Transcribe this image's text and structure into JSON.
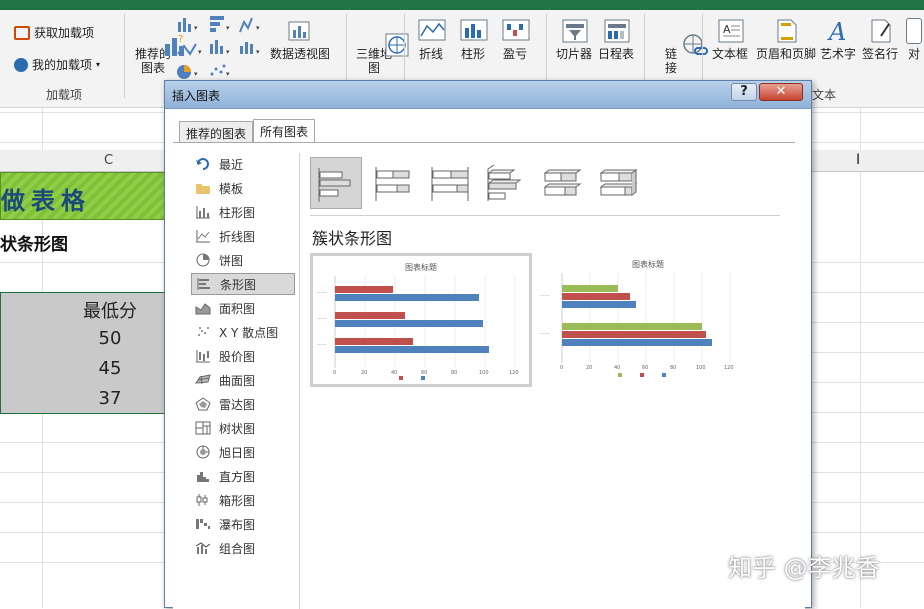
{
  "ribbon": {
    "get_addins": "获取加载项",
    "my_addins": "我的加载项",
    "addins_group": "加载项",
    "recommended_charts": "推荐的\n图表",
    "pivot_chart": "数据透视图",
    "map_3d": "三维地\n图",
    "line": "折线",
    "column": "柱形",
    "winloss": "盈亏",
    "slicer": "切片器",
    "timeline": "日程表",
    "link": "链\n接",
    "textbox": "文本框",
    "header_footer": "页眉和页脚",
    "wordart": "艺术字",
    "signature": "签名行",
    "object": "对",
    "text_group": "文本"
  },
  "sheet": {
    "col_c": "C",
    "col_i_cursor": "I",
    "banner": "做表格",
    "subtitle": "状条形图",
    "header_min": "最低分",
    "values": [
      "50",
      "45",
      "37"
    ]
  },
  "dialog": {
    "title": "插入图表",
    "help": "?",
    "close": "✕",
    "tabs": [
      "推荐的图表",
      "所有图表"
    ],
    "active_tab": 1,
    "chart_types": [
      "最近",
      "模板",
      "柱形图",
      "折线图",
      "饼图",
      "条形图",
      "面积图",
      "X Y 散点图",
      "股价图",
      "曲面图",
      "雷达图",
      "树状图",
      "旭日图",
      "直方图",
      "箱形图",
      "瀑布图",
      "组合图"
    ],
    "selected_type": 5,
    "section_title": "簇状条形图",
    "preview_title": "图表标题"
  },
  "watermark": "知乎 @李兆香",
  "colors": {
    "excel_green": "#217346",
    "series_blue": "#4f81bd",
    "series_red": "#c0504d",
    "series_green": "#9bbb59"
  }
}
